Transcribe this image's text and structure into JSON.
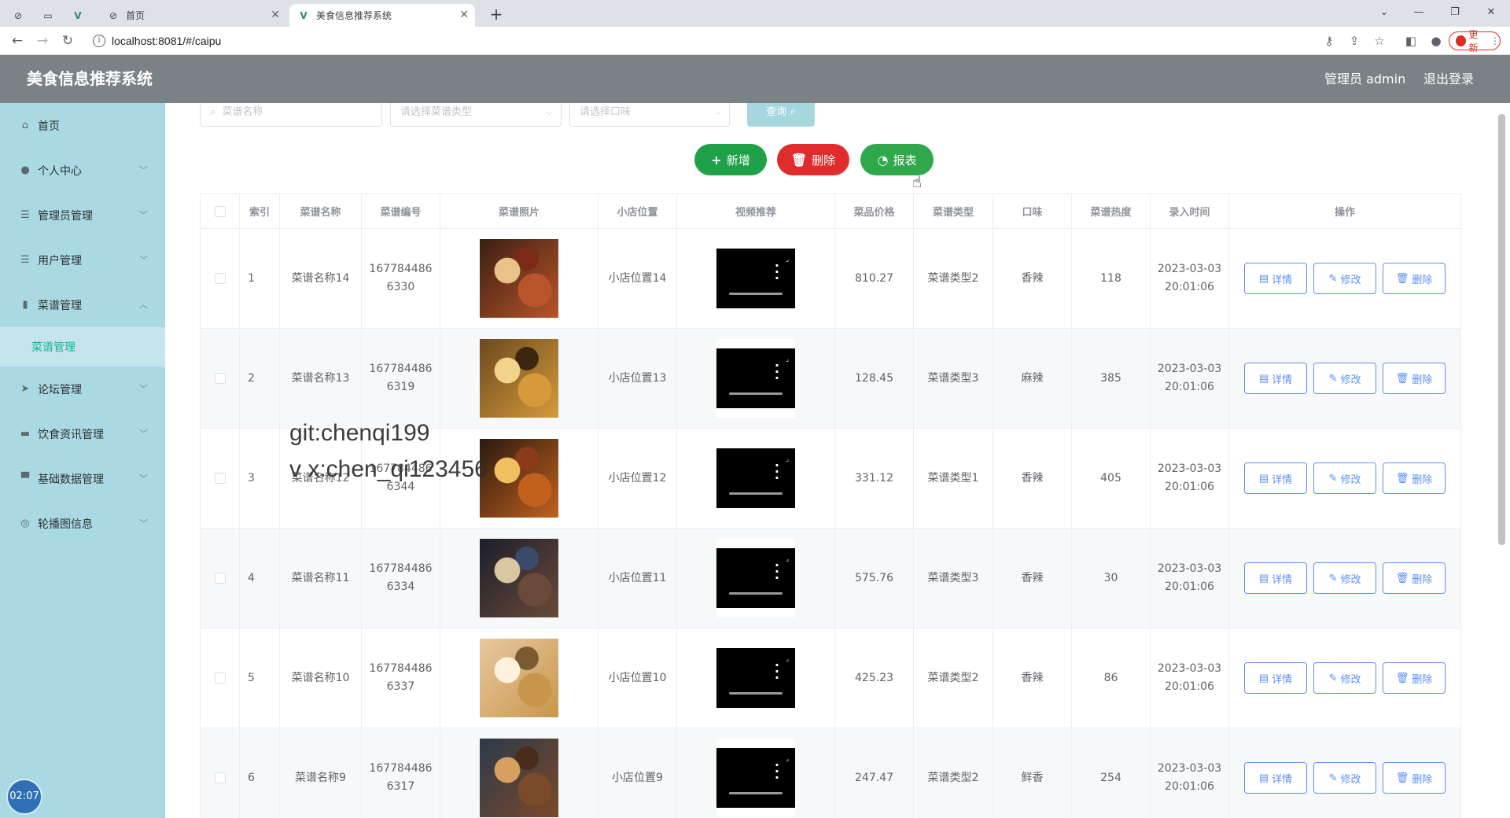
{
  "browser": {
    "tabs": [
      {
        "title": "首页",
        "active": false
      },
      {
        "title": "美食信息推荐系统",
        "active": true
      }
    ],
    "url": "localhost:8081/#/caipu",
    "update_label": "更新"
  },
  "header": {
    "title": "美食信息推荐系统",
    "user": "管理员 admin",
    "logout": "退出登录"
  },
  "sidebar": {
    "items": [
      {
        "label": "首页",
        "icon": "home-icon"
      },
      {
        "label": "个人中心",
        "icon": "user-icon"
      },
      {
        "label": "管理员管理",
        "icon": "list-icon"
      },
      {
        "label": "用户管理",
        "icon": "list-icon"
      },
      {
        "label": "菜谱管理",
        "icon": "chart-icon",
        "expanded": true,
        "sub": "菜谱管理"
      },
      {
        "label": "论坛管理",
        "icon": "send-icon"
      },
      {
        "label": "饮食资讯管理",
        "icon": "briefcase-icon"
      },
      {
        "label": "基础数据管理",
        "icon": "monitor-icon"
      },
      {
        "label": "轮播图信息",
        "icon": "compass-icon"
      }
    ],
    "clock": "02:07"
  },
  "filters": {
    "name_placeholder": "菜谱名称",
    "type_placeholder": "请选择菜谱类型",
    "taste_placeholder": "请选择口味",
    "query_label": "查询"
  },
  "actions": {
    "add": "新增",
    "delete": "删除",
    "report": "报表"
  },
  "table": {
    "columns": [
      "索引",
      "菜谱名称",
      "菜谱编号",
      "菜谱照片",
      "小店位置",
      "视频推荐",
      "菜品价格",
      "菜谱类型",
      "口味",
      "菜谱热度",
      "录入时间",
      "操作"
    ],
    "rows": [
      {
        "index": "1",
        "name": "菜谱名称14",
        "code_line1": "167784486",
        "code_line2": "6330",
        "location": "小店位置14",
        "price": "810.27",
        "type": "菜谱类型2",
        "taste": "香辣",
        "heat": "118",
        "date": "2023-03-03",
        "time": "20:01:06"
      },
      {
        "index": "2",
        "name": "菜谱名称13",
        "code_line1": "167784486",
        "code_line2": "6319",
        "location": "小店位置13",
        "price": "128.45",
        "type": "菜谱类型3",
        "taste": "麻辣",
        "heat": "385",
        "date": "2023-03-03",
        "time": "20:01:06"
      },
      {
        "index": "3",
        "name": "菜谱名称12",
        "code_line1": "167784486",
        "code_line2": "6344",
        "location": "小店位置12",
        "price": "331.12",
        "type": "菜谱类型1",
        "taste": "香辣",
        "heat": "405",
        "date": "2023-03-03",
        "time": "20:01:06"
      },
      {
        "index": "4",
        "name": "菜谱名称11",
        "code_line1": "167784486",
        "code_line2": "6334",
        "location": "小店位置11",
        "price": "575.76",
        "type": "菜谱类型3",
        "taste": "香辣",
        "heat": "30",
        "date": "2023-03-03",
        "time": "20:01:06"
      },
      {
        "index": "5",
        "name": "菜谱名称10",
        "code_line1": "167784486",
        "code_line2": "6337",
        "location": "小店位置10",
        "price": "425.23",
        "type": "菜谱类型2",
        "taste": "香辣",
        "heat": "86",
        "date": "2023-03-03",
        "time": "20:01:06"
      },
      {
        "index": "6",
        "name": "菜谱名称9",
        "code_line1": "167784486",
        "code_line2": "6317",
        "location": "小店位置9",
        "price": "247.47",
        "type": "菜谱类型2",
        "taste": "鲜香",
        "heat": "254",
        "date": "2023-03-03",
        "time": "20:01:06"
      }
    ],
    "op_detail": "详情",
    "op_edit": "修改",
    "op_delete": "删除"
  },
  "watermark": {
    "line1": "git:chenqi199",
    "line2": "v x:chen_qi123456"
  },
  "colors": {
    "header_bg": "#7b8285",
    "sidebar_bg": "#a9d9e2",
    "accent": "#19b394",
    "add_btn": "#1fa14a",
    "delete_btn": "#e02c2c",
    "report_btn": "#2ea84a",
    "op_btn": "#5b8ff9"
  }
}
